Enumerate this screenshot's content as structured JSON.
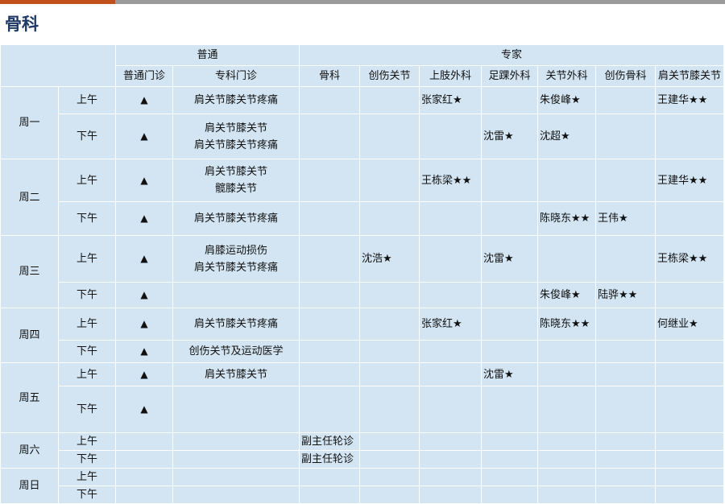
{
  "page": {
    "title": "骨科",
    "accent_color": "#c0501c",
    "cell_color": "#d3e5f2",
    "title_color": "#1f3864"
  },
  "header": {
    "group_general": "普通",
    "group_expert": "专家",
    "columns": [
      "普通门诊",
      "专科门诊",
      "骨科",
      "创伤关节",
      "上肢外科",
      "足踝外科",
      "关节外科",
      "创伤骨科",
      "肩关节膝关节"
    ]
  },
  "days": [
    {
      "day": "周一",
      "sessions": [
        {
          "period": "上午",
          "cells": [
            "▲",
            [
              "肩关节膝关节疼痛"
            ],
            "",
            "",
            "张家红★",
            "",
            "朱俊峰★",
            "",
            "王建华★★"
          ]
        },
        {
          "period": "下午",
          "cells": [
            "▲",
            [
              "肩关节膝关节",
              "肩关节膝关节疼痛"
            ],
            "",
            "",
            "",
            "沈雷★",
            "沈超★",
            "",
            ""
          ]
        }
      ]
    },
    {
      "day": "周二",
      "sessions": [
        {
          "period": "上午",
          "cells": [
            "▲",
            [
              "肩关节膝关节",
              "髋膝关节"
            ],
            "",
            "",
            "王栋梁★★",
            "",
            "",
            "",
            "王建华★★"
          ]
        },
        {
          "period": "下午",
          "cells": [
            "▲",
            [
              "肩关节膝关节疼痛"
            ],
            "",
            "",
            "",
            "",
            "陈晓东★★",
            "王伟★",
            ""
          ]
        }
      ]
    },
    {
      "day": "周三",
      "sessions": [
        {
          "period": "上午",
          "cells": [
            "▲",
            [
              "肩膝运动损伤",
              "肩关节膝关节疼痛"
            ],
            "",
            "沈浩★",
            "",
            "沈雷★",
            "",
            "",
            "王栋梁★★"
          ]
        },
        {
          "period": "下午",
          "cells": [
            "▲",
            [],
            "",
            "",
            "",
            "",
            "朱俊峰★",
            "陆骅★★",
            ""
          ]
        }
      ]
    },
    {
      "day": "周四",
      "sessions": [
        {
          "period": "上午",
          "cells": [
            "▲",
            [
              "肩关节膝关节疼痛"
            ],
            "",
            "",
            "张家红★",
            "",
            "陈晓东★★",
            "",
            "何继业★"
          ]
        },
        {
          "period": "下午",
          "cells": [
            "▲",
            [
              "创伤关节及运动医学"
            ],
            "",
            "",
            "",
            "",
            "",
            "",
            ""
          ]
        }
      ]
    },
    {
      "day": "周五",
      "sessions": [
        {
          "period": "上午",
          "cells": [
            "▲",
            [
              "肩关节膝关节"
            ],
            "",
            "",
            "",
            "沈雷★",
            "",
            "",
            ""
          ]
        },
        {
          "period": "下午",
          "cells": [
            "▲",
            [],
            "",
            "",
            "",
            "",
            "",
            "",
            ""
          ]
        }
      ]
    },
    {
      "day": "周六",
      "sessions": [
        {
          "period": "上午",
          "cells": [
            "",
            [],
            "副主任轮诊",
            "",
            "",
            "",
            "",
            "",
            ""
          ]
        },
        {
          "period": "下午",
          "cells": [
            "",
            [],
            "副主任轮诊",
            "",
            "",
            "",
            "",
            "",
            ""
          ]
        }
      ]
    },
    {
      "day": "周日",
      "sessions": [
        {
          "period": "上午",
          "cells": [
            "",
            [],
            "",
            "",
            "",
            "",
            "",
            "",
            ""
          ]
        },
        {
          "period": "下午",
          "cells": [
            "",
            [],
            "",
            "",
            "",
            "",
            "",
            "",
            ""
          ]
        }
      ]
    }
  ]
}
